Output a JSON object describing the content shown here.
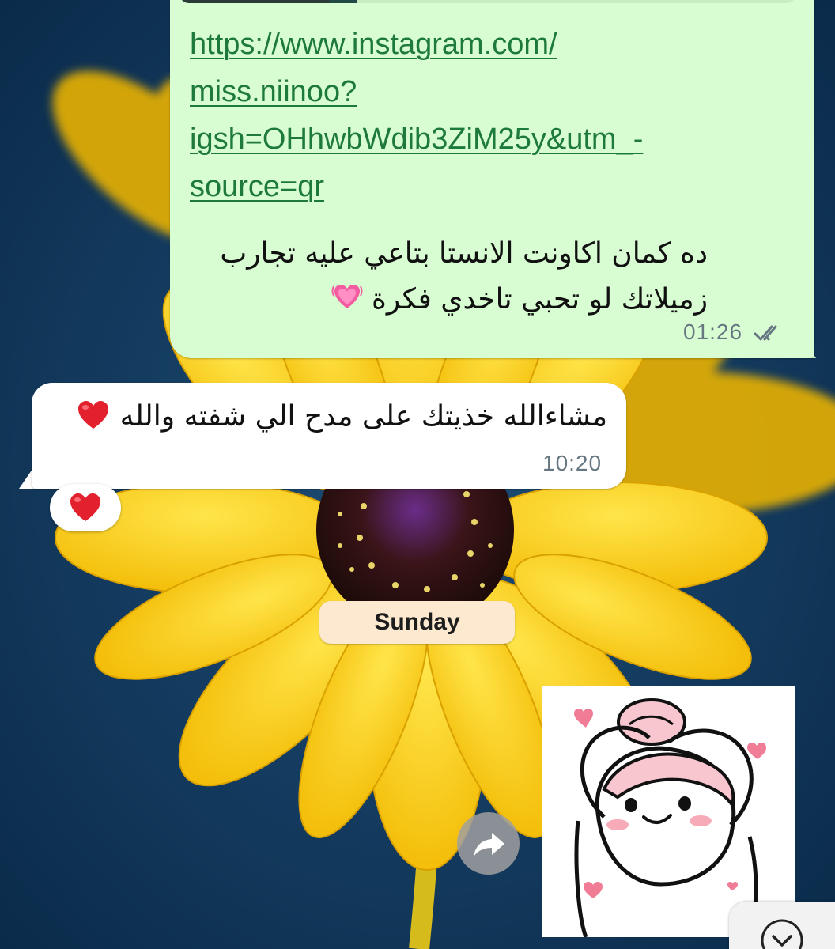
{
  "chat": {
    "outgoing": {
      "link_lines": [
        "https://www.instagram.com/",
        "miss.niinoo?",
        "igsh=OHhwbWdib3ZiM25y&utm_-",
        "source=qr"
      ],
      "text_line1": "ده كمان اكاونت الانستا بتاعي عليه تجارب",
      "text_line2": "زميلاتك لو تحبي تاخدي فكرة",
      "emoji": "growing-heart-emoji",
      "time": "01:26",
      "status": "read"
    },
    "incoming": {
      "text": "مشاءالله خذيتك على مدح الي شفته والله",
      "emoji": "red-heart-emoji",
      "time": "10:20",
      "reaction": "red-heart-emoji"
    },
    "date_separator": "Sunday",
    "sticker": {
      "description_icon": "heart-hands-character-sticker"
    }
  },
  "colors": {
    "outgoing_bubble": "#d9fdd3",
    "incoming_bubble": "#ffffff",
    "link": "#1e7a3c",
    "timestamp": "#667781",
    "date_chip": "#fde9d0"
  },
  "icons": {
    "forward": "forward-arrow-icon",
    "scroll_down": "chevron-down-icon",
    "read_receipt": "double-check-icon"
  }
}
